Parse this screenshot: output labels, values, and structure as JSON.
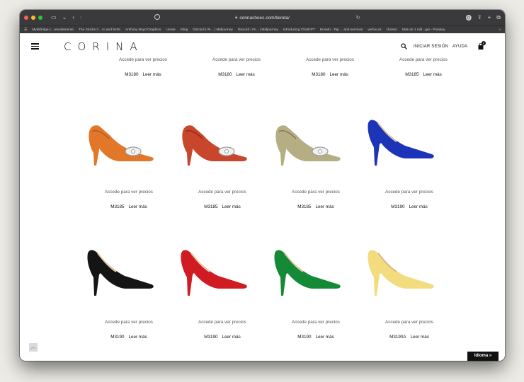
{
  "browser": {
    "url": "corinashoes.com/tienda/",
    "bookmarks": [
      "Mykitfridge.c...resultamente",
      "The Stocks 3 ...ro and fertst",
      "Anthony Boyd Graphics",
      "create",
      "Sling",
      "Discord | #s... | Midjourney",
      "Discord | #n... | Midjourney",
      "Introducing ChatGPT",
      "Envato - Tap ... and services",
      "verbix.es",
      "chosen",
      "Más de 1 mill...gar - Pixabay"
    ]
  },
  "header": {
    "logo": "CORINA",
    "login_label": "INICIAR SESIÓN",
    "help_label": "AYUDA",
    "cart_count": "0"
  },
  "products": {
    "price_note": "Accede para ver precios",
    "more_label": "Leer más",
    "row0": [
      {
        "code": "M3180"
      },
      {
        "code": "M3180"
      },
      {
        "code": "M3180"
      },
      {
        "code": "M3185"
      }
    ],
    "row1": [
      {
        "code": "M3185",
        "color": "#e2772a"
      },
      {
        "code": "M3185",
        "color": "#c7462c"
      },
      {
        "code": "M3185",
        "color": "#b5ae84"
      },
      {
        "code": "M3190",
        "color": "#1c35b8"
      }
    ],
    "row2": [
      {
        "code": "M3190",
        "color": "#141414"
      },
      {
        "code": "M3190",
        "color": "#d01b23"
      },
      {
        "code": "M3190",
        "color": "#158a36"
      },
      {
        "code": "M3190A",
        "color": "#f3dc7e"
      }
    ]
  },
  "footer": {
    "language_label": "Idioma »"
  }
}
